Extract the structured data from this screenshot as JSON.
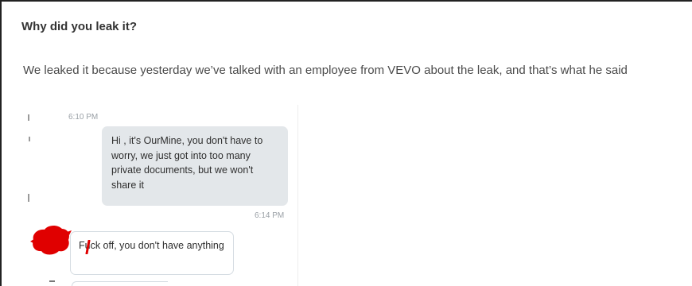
{
  "article": {
    "heading": "Why did you leak it?",
    "paragraph": "We leaked it because yesterday we’ve talked with an employee from VEVO about the leak, and that’s what he said"
  },
  "chat": {
    "messages": [
      {
        "direction": "outgoing",
        "timestamp": "6:10 PM",
        "text": "Hi , it's OurMine, you don't have to worry, we just got into too many private documents, but we won't share it"
      },
      {
        "direction": "incoming",
        "timestamp": "6:14 PM",
        "text": "Fuck off, you don't have anything",
        "sender_avatar": "redacted"
      }
    ]
  },
  "colors": {
    "heading": "#333333",
    "body_text": "#4a4a4a",
    "outgoing_bubble": "#e3e7ea",
    "incoming_bubble_border": "#d5dce2",
    "timestamp": "#9aa0a6",
    "redaction": "#e00000"
  }
}
